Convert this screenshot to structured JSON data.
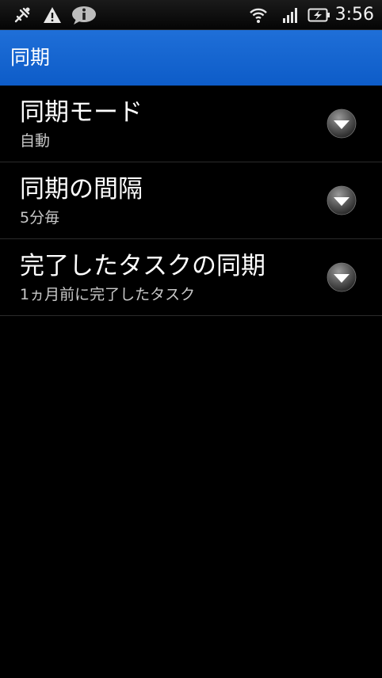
{
  "status_bar": {
    "time": "3:56",
    "icons": [
      "usb-debug-icon",
      "warning-icon",
      "info-bubble-icon",
      "wifi-icon",
      "signal-icon",
      "battery-charging-icon"
    ]
  },
  "header": {
    "title": "同期"
  },
  "settings": [
    {
      "title": "同期モード",
      "summary": "自動"
    },
    {
      "title": "同期の間隔",
      "summary": "5分毎"
    },
    {
      "title": "完了したタスクの同期",
      "summary": "1ヵ月前に完了したタスク"
    }
  ],
  "colors": {
    "accent": "#1466d4",
    "background": "#000000",
    "divider": "#2b2b2b"
  }
}
